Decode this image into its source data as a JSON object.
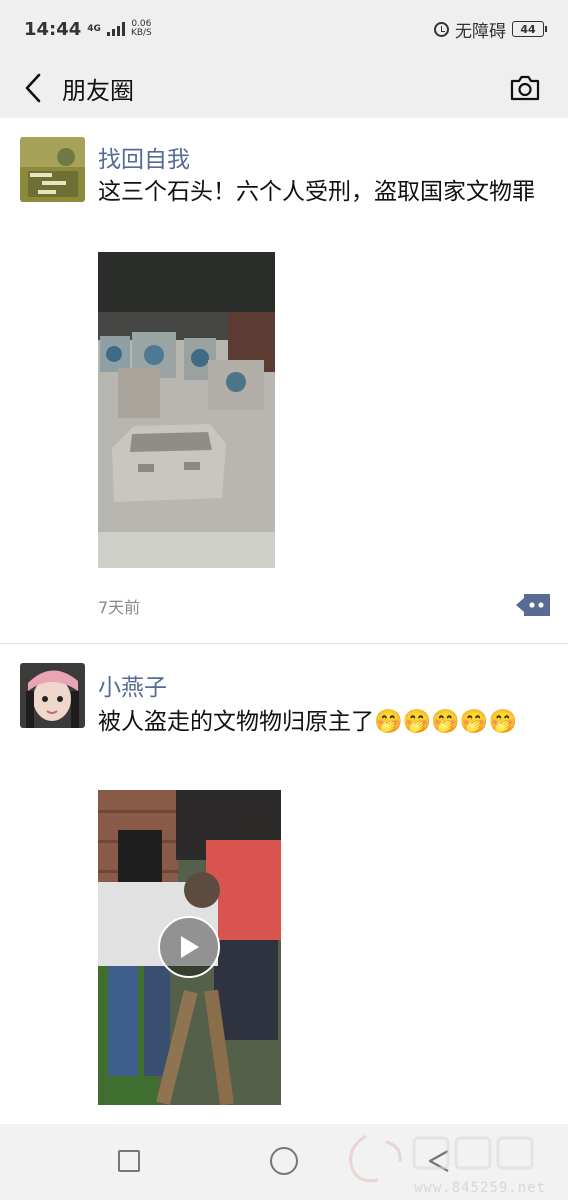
{
  "status_bar": {
    "time": "14:44",
    "network_type": "4G",
    "net_speed_value": "0.06",
    "net_speed_unit": "KB/S",
    "accessibility_label": "无障碍",
    "battery_level": "44"
  },
  "nav": {
    "title": "朋友圈",
    "back_icon": "chevron-left-icon",
    "camera_icon": "camera-icon"
  },
  "posts": [
    {
      "author": "找回自我",
      "text": "这三个石头！六个人受刑，盗取国家文物罪",
      "media_type": "photo",
      "timestamp": "7天前"
    },
    {
      "author": "小燕子",
      "text": "被人盗走的文物物归原主了🤭🤭🤭🤭🤭",
      "media_type": "video"
    }
  ],
  "watermark": {
    "domain": "www.845259.net"
  },
  "colors": {
    "author_link": "#576b95",
    "header_bg": "#efefef",
    "more_button": "#576b95"
  }
}
